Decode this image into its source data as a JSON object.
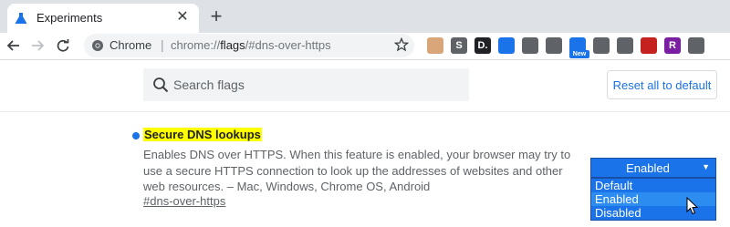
{
  "browser": {
    "tab": {
      "title": "Experiments",
      "icon": "flask-icon",
      "close_glyph": "✕"
    },
    "new_tab_glyph": "+",
    "omnibox": {
      "site_label": "Chrome",
      "separator": "|",
      "url_prefix": "chrome://",
      "url_strong": "flags",
      "url_suffix": "/#dns-over-https"
    },
    "extensions": [
      {
        "name": "ext-face-icon",
        "glyph": "",
        "color": "#d9a679"
      },
      {
        "name": "ext-s-icon",
        "glyph": "S",
        "color": "#5f6368"
      },
      {
        "name": "ext-d-icon",
        "glyph": "D.",
        "color": "#202124"
      },
      {
        "name": "ext-bookmark-icon",
        "glyph": "",
        "color": "#1a73e8"
      },
      {
        "name": "ext-arrow-icon",
        "glyph": "",
        "color": "#5f6368"
      },
      {
        "name": "ext-glasses-icon",
        "glyph": "",
        "color": "#5f6368"
      },
      {
        "name": "ext-new-icon",
        "glyph": "",
        "color": "#1a73e8",
        "badge": "New"
      },
      {
        "name": "ext-filter-icon",
        "glyph": "",
        "color": "#5f6368"
      },
      {
        "name": "ext-mascot-icon",
        "glyph": "",
        "color": "#5f6368"
      },
      {
        "name": "ext-redarrow-icon",
        "glyph": "",
        "color": "#c5221f"
      },
      {
        "name": "ext-r-icon",
        "glyph": "R",
        "color": "#7b1fa2"
      },
      {
        "name": "ext-dots-icon",
        "glyph": "",
        "color": "#5f6368"
      }
    ]
  },
  "flags": {
    "search_placeholder": "Search flags",
    "reset_label": "Reset all to default"
  },
  "experiment": {
    "title": "Secure DNS lookups",
    "description": "Enables DNS over HTTPS. When this feature is enabled, your browser may try to use a secure HTTPS connection to look up the addresses of websites and other web resources. – Mac, Windows, Chrome OS, Android",
    "link": "#dns-over-https",
    "select": {
      "value": "Enabled",
      "arrow": "▼",
      "options": [
        "Default",
        "Enabled",
        "Disabled"
      ],
      "highlighted": "Enabled"
    }
  },
  "colors": {
    "accent": "#1a73e8",
    "highlight": "#ffff00",
    "tabstrip": "#dee1e6"
  }
}
